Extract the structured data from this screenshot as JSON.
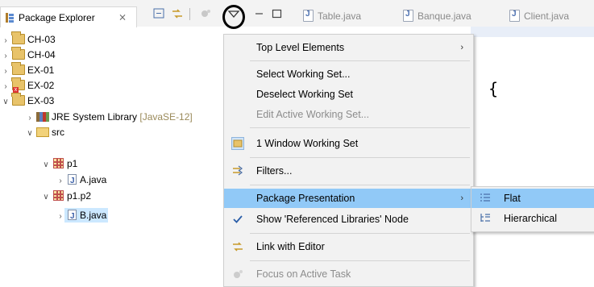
{
  "view_tab": {
    "label": "Package Explorer"
  },
  "editor_tabs": [
    {
      "label": "Table.java"
    },
    {
      "label": "Banque.java"
    },
    {
      "label": "Client.java"
    }
  ],
  "tree": [
    {
      "label": "CH-03",
      "kind": "project",
      "expanded": false
    },
    {
      "label": "CH-04",
      "kind": "project",
      "expanded": false
    },
    {
      "label": "EX-01",
      "kind": "project",
      "expanded": false
    },
    {
      "label": "EX-02",
      "kind": "project-error",
      "expanded": false
    },
    {
      "label": "EX-03",
      "kind": "project",
      "expanded": true
    },
    {
      "label": "JRE System Library",
      "suffix": "[JavaSE-12]",
      "kind": "library"
    },
    {
      "label": "src",
      "kind": "source-folder"
    },
    {
      "label": "p1",
      "kind": "package"
    },
    {
      "label": "A.java",
      "kind": "java-file"
    },
    {
      "label": "p1.p2",
      "kind": "package"
    },
    {
      "label": "B.java",
      "kind": "java-file",
      "selected": true
    }
  ],
  "editor_code": {
    "brace": "{"
  },
  "view_menu": [
    {
      "label": "Top Level Elements",
      "submenu": true
    },
    {
      "label": "Select Working Set..."
    },
    {
      "label": "Deselect Working Set"
    },
    {
      "label": "Edit Active Working Set...",
      "disabled": true
    },
    {
      "label": "1 Window Working Set"
    },
    {
      "label": "Filters..."
    },
    {
      "label": "Package Presentation",
      "submenu": true,
      "highlighted": true
    },
    {
      "label": "Show 'Referenced Libraries' Node",
      "checked": true
    },
    {
      "label": "Link with Editor"
    },
    {
      "label": "Focus on Active Task",
      "disabled": true
    }
  ],
  "submenu": [
    {
      "label": "Flat",
      "highlighted": true
    },
    {
      "label": "Hierarchical"
    }
  ],
  "colors": {
    "highlight": "#91c9f7",
    "selection": "#cce8ff",
    "menu_bg": "#f2f2f2",
    "annotation": "#000000"
  },
  "icons": {
    "view_menu_trigger": "chevron-down-icon",
    "checkmark": "checkmark-icon"
  }
}
